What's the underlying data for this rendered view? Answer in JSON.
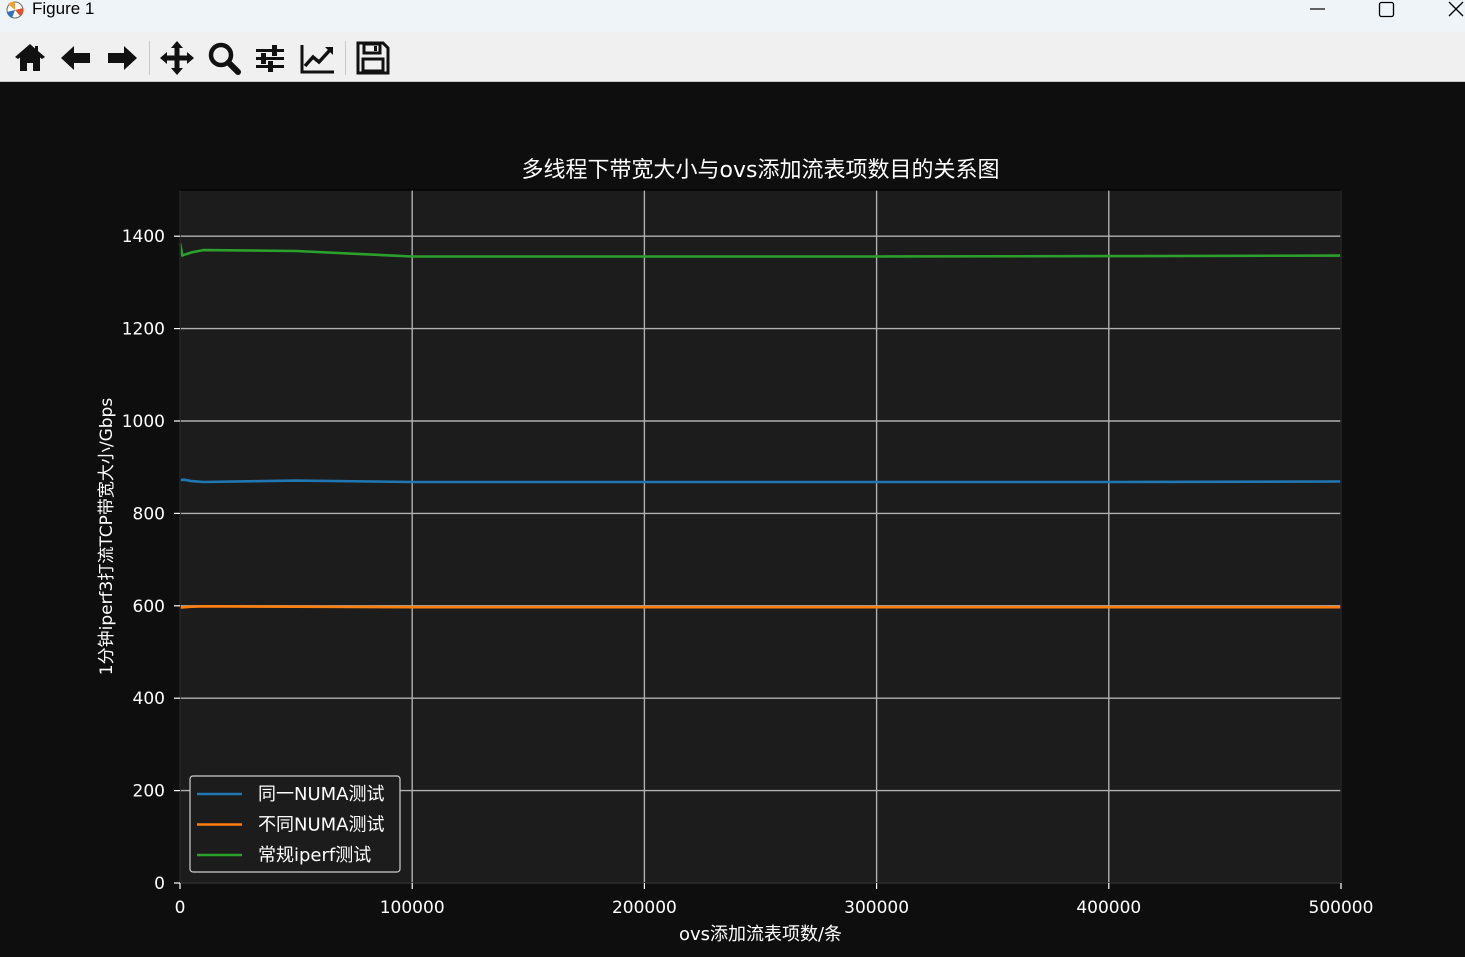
{
  "window": {
    "title": "Figure 1",
    "app_icon": "matplotlib-icon",
    "controls": [
      "minimize-icon",
      "maximize-icon",
      "close-icon"
    ]
  },
  "toolbar": {
    "tools": [
      {
        "name": "home",
        "icon": "home-icon"
      },
      {
        "name": "back",
        "icon": "arrow-left-icon"
      },
      {
        "name": "forward",
        "icon": "arrow-right-icon"
      },
      {
        "name": "pan",
        "icon": "move-icon"
      },
      {
        "name": "zoom",
        "icon": "magnifier-icon"
      },
      {
        "name": "configure-subplots",
        "icon": "sliders-icon"
      },
      {
        "name": "edit-axis",
        "icon": "line-chart-icon"
      },
      {
        "name": "save",
        "icon": "floppy-disk-icon"
      }
    ]
  },
  "colors": {
    "figure_bg": "#0e0e0e",
    "axes_bg": "#1c1c1c",
    "grid": "#b0b0b0",
    "text": "#ffffff"
  },
  "chart_data": {
    "type": "line",
    "title": "多线程下带宽大小与ovs添加流表项数目的关系图",
    "xlabel": "ovs添加流表项数/条",
    "ylabel": "1分钟iperf3打流TCP带宽大小/Gbps",
    "xlim": [
      0,
      500000
    ],
    "ylim": [
      0,
      1500
    ],
    "xticks": [
      0,
      100000,
      200000,
      300000,
      400000,
      500000
    ],
    "yticks": [
      0,
      200,
      400,
      600,
      800,
      1000,
      1200,
      1400
    ],
    "grid": true,
    "legend_position": "lower-left",
    "series": [
      {
        "name": "同一NUMA测试",
        "color": "#1f77b4",
        "x": [
          0,
          2000,
          5000,
          10000,
          50000,
          100000,
          200000,
          300000,
          400000,
          500000
        ],
        "y": [
          872,
          873,
          870,
          868,
          871,
          868,
          868,
          868,
          868,
          869
        ]
      },
      {
        "name": "不同NUMA测试",
        "color": "#ff7f0e",
        "x": [
          0,
          2000,
          5000,
          10000,
          50000,
          100000,
          200000,
          300000,
          400000,
          500000
        ],
        "y": [
          596,
          597,
          598,
          599,
          598,
          597,
          597,
          597,
          597,
          597
        ]
      },
      {
        "name": "常规iperf测试",
        "color": "#2ca02c",
        "x": [
          0,
          1000,
          2000,
          5000,
          10000,
          50000,
          100000,
          200000,
          300000,
          400000,
          500000
        ],
        "y": [
          1385,
          1358,
          1360,
          1365,
          1370,
          1368,
          1356,
          1356,
          1356,
          1357,
          1358
        ]
      }
    ]
  }
}
